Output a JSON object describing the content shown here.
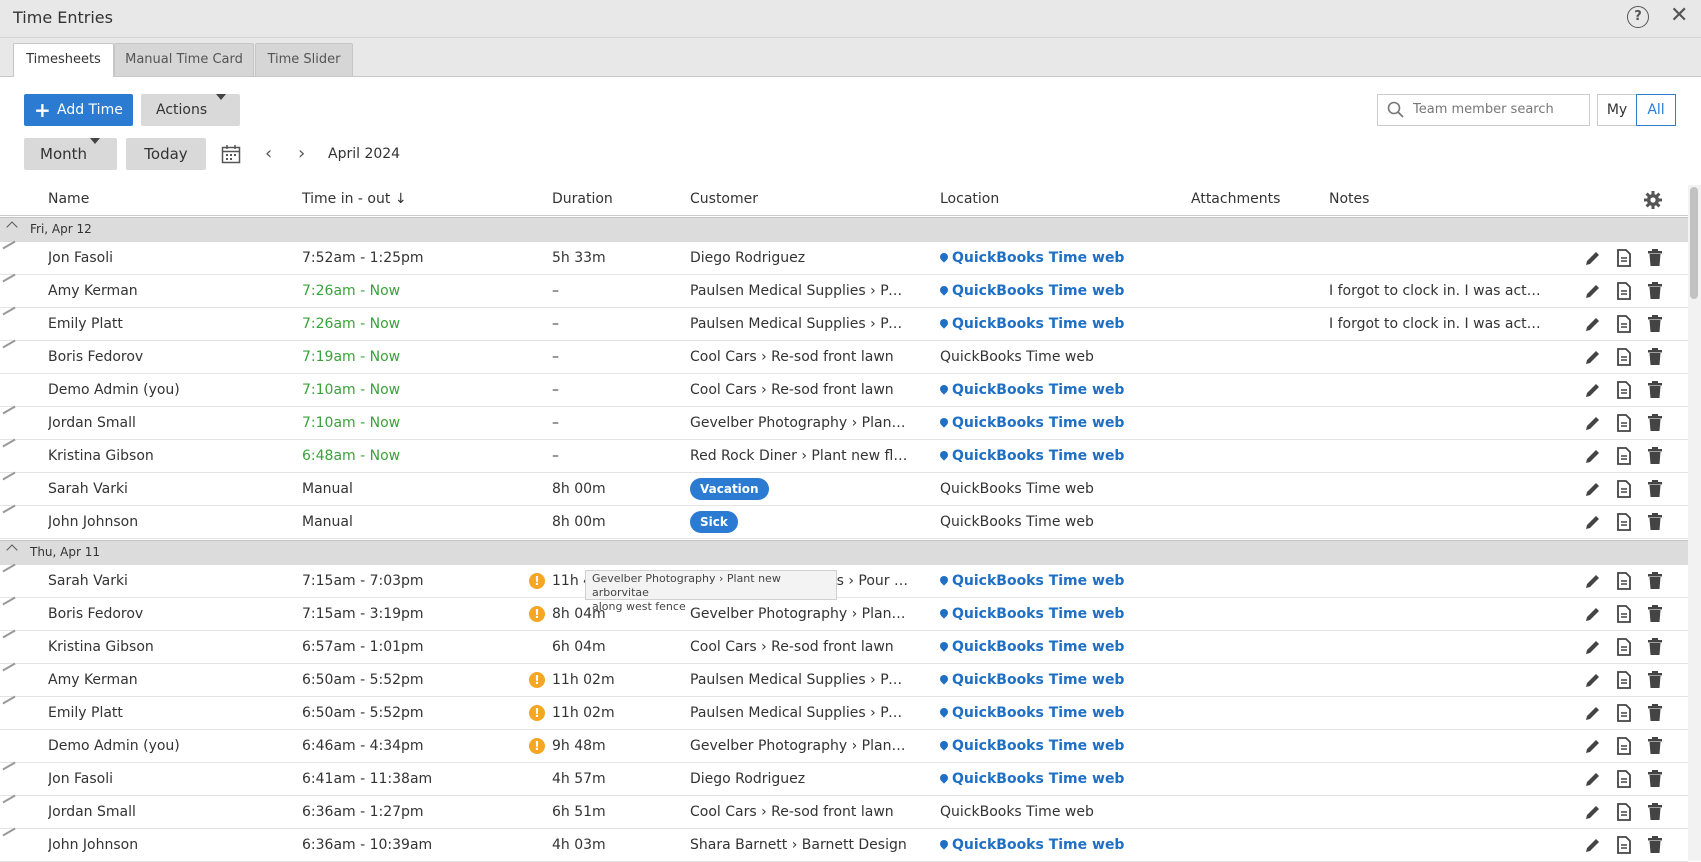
{
  "window": {
    "title": "Time Entries"
  },
  "tabs": [
    {
      "label": "Timesheets"
    },
    {
      "label": "Manual Time Card"
    },
    {
      "label": "Time Slider"
    }
  ],
  "toolbar": {
    "add_time": "Add Time",
    "actions": "Actions",
    "month": "Month",
    "today": "Today",
    "period": "April 2024",
    "search_placeholder": "Team member search",
    "my": "My",
    "all": "All"
  },
  "columns": {
    "name": "Name",
    "time": "Time in - out",
    "duration": "Duration",
    "customer": "Customer",
    "location": "Location",
    "attachments": "Attachments",
    "notes": "Notes"
  },
  "groups": [
    {
      "label": "Fri, Apr 12"
    },
    {
      "label": "Thu, Apr 11"
    }
  ],
  "rows": [
    {
      "name": "Jon Fasoli",
      "time": "7:52am - 1:25pm",
      "dur": "5h 33m",
      "cust": "Diego Rodriguez",
      "loc": "QuickBooks Time web",
      "notes": ""
    },
    {
      "name": "Amy Kerman",
      "time": "7:26am - Now",
      "dur": "–",
      "cust": "Paulsen Medical Supplies › Pour …",
      "loc": "QuickBooks Time web",
      "notes": "I forgot to clock in. I was actuall…"
    },
    {
      "name": "Emily Platt",
      "time": "7:26am - Now",
      "dur": "–",
      "cust": "Paulsen Medical Supplies › Pour …",
      "loc": "QuickBooks Time web",
      "notes": "I forgot to clock in. I was actuall…"
    },
    {
      "name": "Boris Fedorov",
      "time": "7:19am - Now",
      "dur": "–",
      "cust": "Cool Cars › Re-sod front lawn",
      "loc": "QuickBooks Time web",
      "notes": ""
    },
    {
      "name": "Demo Admin (you)",
      "time": "7:10am - Now",
      "dur": "–",
      "cust": "Cool Cars › Re-sod front lawn",
      "loc": "QuickBooks Time web",
      "notes": ""
    },
    {
      "name": "Jordan Small",
      "time": "7:10am - Now",
      "dur": "–",
      "cust": "Gevelber Photography › Plant ne…",
      "loc": "QuickBooks Time web",
      "notes": ""
    },
    {
      "name": "Kristina Gibson",
      "time": "6:48am - Now",
      "dur": "–",
      "cust": "Red Rock Diner › Plant new flow…",
      "loc": "QuickBooks Time web",
      "notes": ""
    },
    {
      "name": "Sarah Varki",
      "time": "Manual",
      "dur": "8h 00m",
      "cust": "Vacation",
      "loc": "QuickBooks Time web",
      "notes": ""
    },
    {
      "name": "John Johnson",
      "time": "Manual",
      "dur": "8h 00m",
      "cust": "Sick",
      "loc": "QuickBooks Time web",
      "notes": ""
    },
    {
      "name": "Sarah Varki",
      "time": "7:15am - 7:03pm",
      "dur": "11h 4",
      "cust": "es › Pour …",
      "loc": "QuickBooks Time web",
      "notes": ""
    },
    {
      "name": "Boris Fedorov",
      "time": "7:15am - 3:19pm",
      "dur": "8h 04m",
      "cust": "Gevelber Photography › Plant ne…",
      "loc": "QuickBooks Time web",
      "notes": ""
    },
    {
      "name": "Kristina Gibson",
      "time": "6:57am - 1:01pm",
      "dur": "6h 04m",
      "cust": "Cool Cars › Re-sod front lawn",
      "loc": "QuickBooks Time web",
      "notes": ""
    },
    {
      "name": "Amy Kerman",
      "time": "6:50am - 5:52pm",
      "dur": "11h 02m",
      "cust": "Paulsen Medical Supplies › Pour …",
      "loc": "QuickBooks Time web",
      "notes": ""
    },
    {
      "name": "Emily Platt",
      "time": "6:50am - 5:52pm",
      "dur": "11h 02m",
      "cust": "Paulsen Medical Supplies › Pour …",
      "loc": "QuickBooks Time web",
      "notes": ""
    },
    {
      "name": "Demo Admin (you)",
      "time": "6:46am - 4:34pm",
      "dur": "9h 48m",
      "cust": "Gevelber Photography › Plant ne…",
      "loc": "QuickBooks Time web",
      "notes": ""
    },
    {
      "name": "Jon Fasoli",
      "time": "6:41am - 11:38am",
      "dur": "4h 57m",
      "cust": "Diego Rodriguez",
      "loc": "QuickBooks Time web",
      "notes": ""
    },
    {
      "name": "Jordan Small",
      "time": "6:36am - 1:27pm",
      "dur": "6h 51m",
      "cust": "Cool Cars › Re-sod front lawn",
      "loc": "QuickBooks Time web",
      "notes": ""
    },
    {
      "name": "John Johnson",
      "time": "6:36am - 10:39am",
      "dur": "4h 03m",
      "cust": "Shara Barnett › Barnett Design",
      "loc": "QuickBooks Time web",
      "notes": ""
    }
  ],
  "tooltip": {
    "line1": "Gevelber Photography › Plant new arborvitae",
    "line2": "along west fence"
  }
}
